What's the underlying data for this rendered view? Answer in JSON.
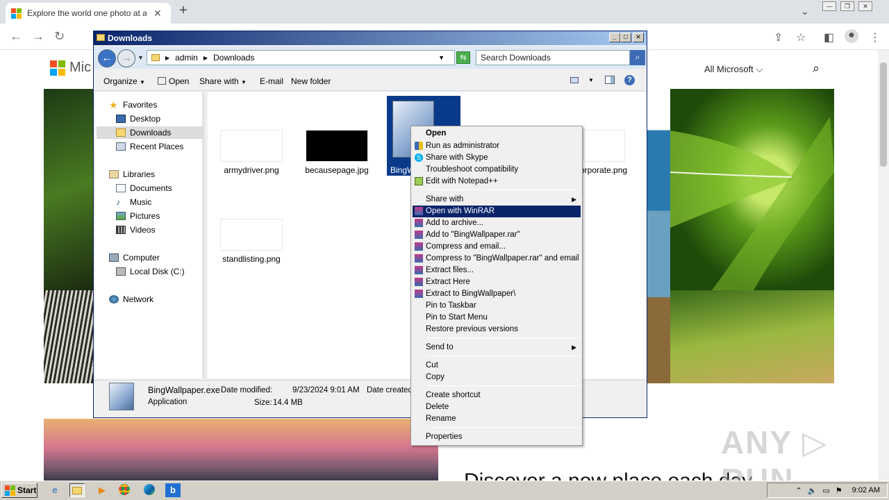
{
  "browser": {
    "tab_title": "Explore the world one photo at a time",
    "tab_close": "✕",
    "new_tab": "+",
    "window_buttons": [
      "—",
      "❐",
      "✕"
    ]
  },
  "page": {
    "logo_text": "Mic",
    "nav_all": "All Microsoft ⌵",
    "headline": "Discover a new place each day"
  },
  "explorer": {
    "title": "Downloads",
    "caption_buttons": [
      "_",
      "□",
      "✕"
    ],
    "breadcrumb": [
      "admin",
      "Downloads"
    ],
    "search_placeholder": "Search Downloads",
    "commands": {
      "organize": "Organize",
      "open": "Open",
      "share_with": "Share with",
      "email": "E-mail",
      "new_folder": "New folder"
    },
    "nav": {
      "favorites": "Favorites",
      "desktop": "Desktop",
      "downloads": "Downloads",
      "recent": "Recent Places",
      "libraries": "Libraries",
      "documents": "Documents",
      "music": "Music",
      "pictures": "Pictures",
      "videos": "Videos",
      "computer": "Computer",
      "local_disk": "Local Disk (C:)",
      "network": "Network"
    },
    "files": {
      "f1": "armydriver.png",
      "f2": "becausepage.jpg",
      "f3": "BingW",
      "f4": "orporate.png",
      "f5": "standlisting.png"
    },
    "details": {
      "name": "BingWallpaper.exe",
      "type": "Application",
      "modified_label": "Date modified:",
      "modified": "9/23/2024 9:01 AM",
      "size_label": "Size:",
      "size": "14.4 MB",
      "created_label": "Date created"
    }
  },
  "context_menu": {
    "open": "Open",
    "run_admin": "Run as administrator",
    "skype": "Share with Skype",
    "troubleshoot": "Troubleshoot compatibility",
    "notepad": "Edit with Notepad++",
    "share_with": "Share with",
    "winrar": "Open with WinRAR",
    "add_archive": "Add to archive...",
    "add_rar": "Add to \"BingWallpaper.rar\"",
    "compress_email": "Compress and email...",
    "compress_rar_email": "Compress to \"BingWallpaper.rar\" and email",
    "extract_files": "Extract files...",
    "extract_here": "Extract Here",
    "extract_to": "Extract to BingWallpaper\\",
    "pin_taskbar": "Pin to Taskbar",
    "pin_start": "Pin to Start Menu",
    "restore": "Restore previous versions",
    "send_to": "Send to",
    "cut": "Cut",
    "copy": "Copy",
    "create_shortcut": "Create shortcut",
    "delete": "Delete",
    "rename": "Rename",
    "properties": "Properties"
  },
  "taskbar": {
    "start": "Start",
    "clock": "9:02 AM"
  },
  "watermark": "ANY ▷ RUN",
  "colors": {
    "menu_highlight": "#0a246a",
    "titlebar_start": "#0a246a",
    "titlebar_end": "#a6caf0"
  }
}
